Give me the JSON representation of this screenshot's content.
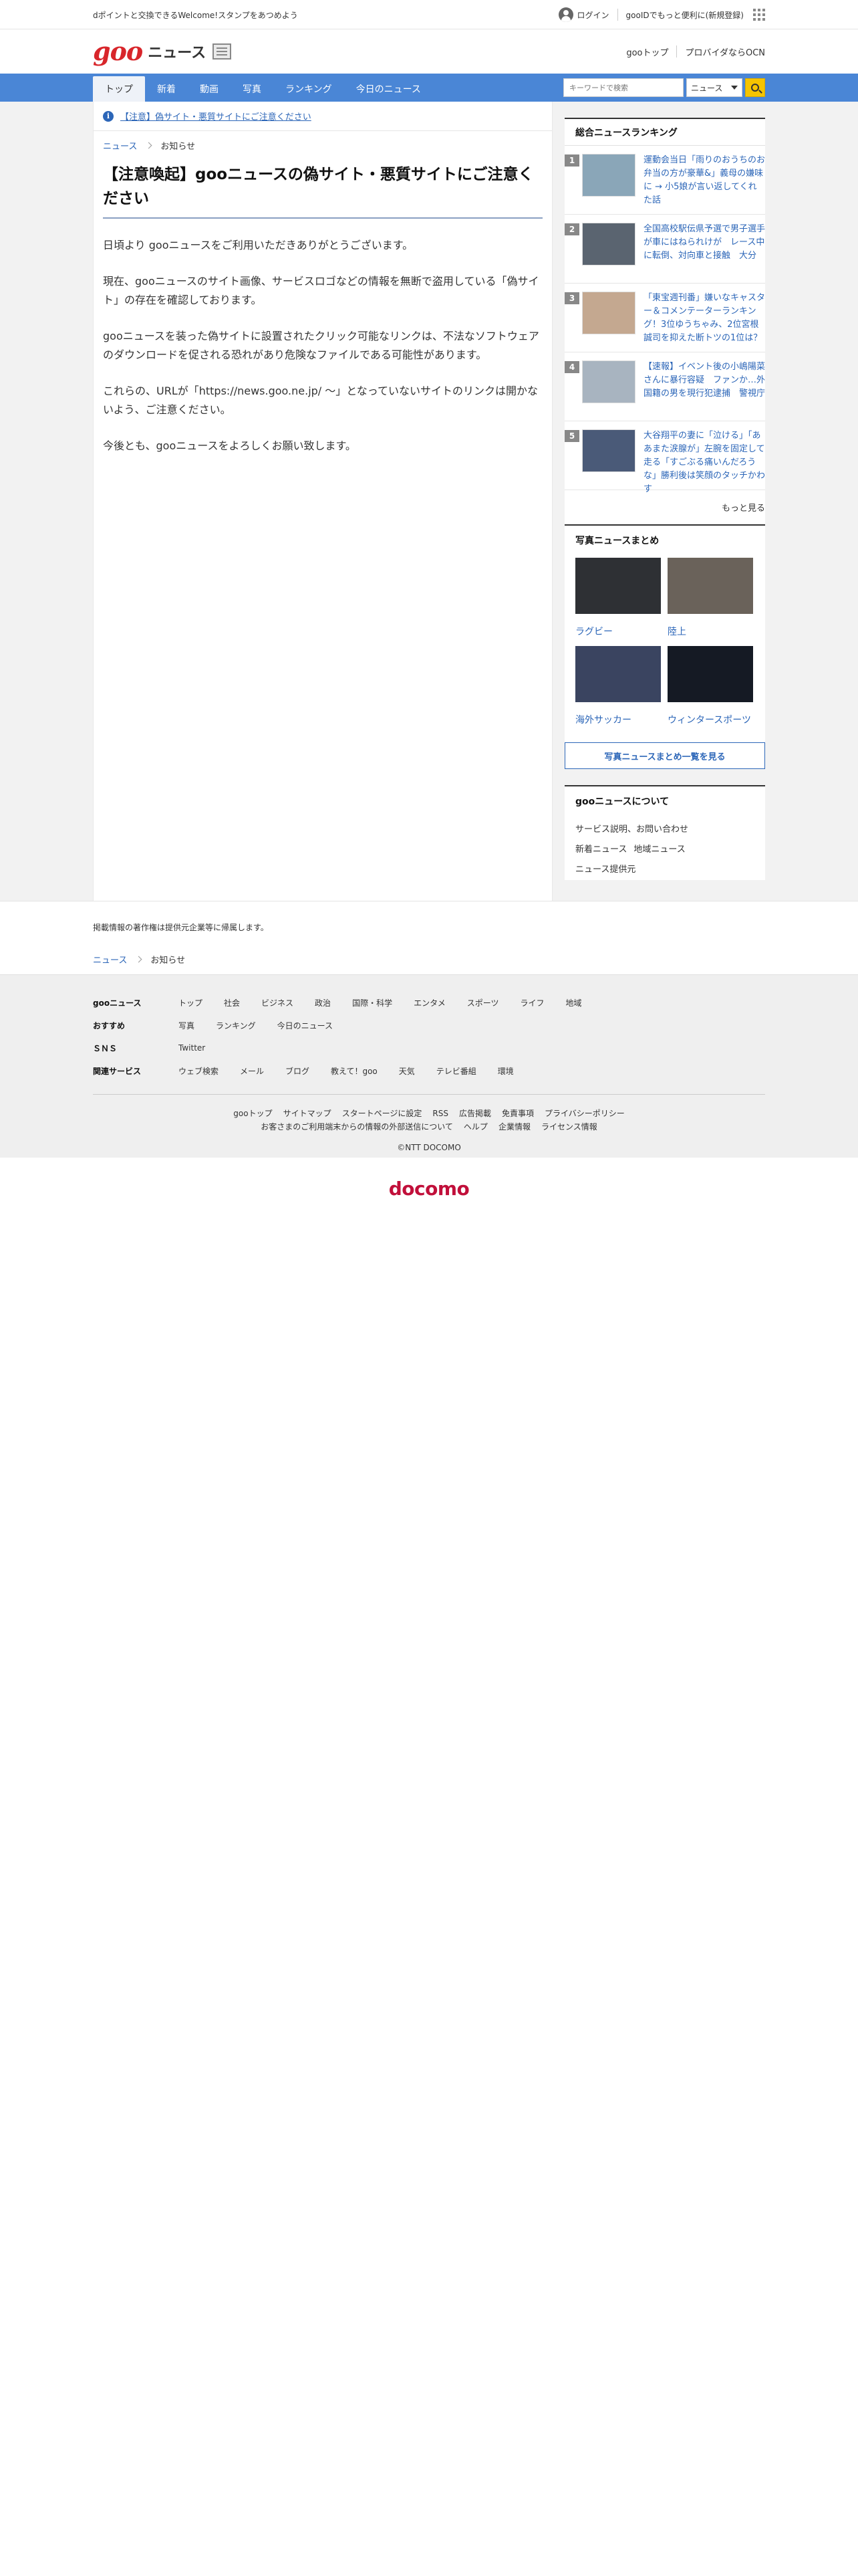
{
  "topbar": {
    "promo": "dポイントと交換できるWelcome!スタンプをあつめよう",
    "login": "ログイン",
    "register": "gooIDでもっと便利に(新規登録)"
  },
  "header": {
    "logo": "goo",
    "site_name": "ニュース",
    "links": [
      "gooトップ",
      "プロバイダならOCN"
    ]
  },
  "nav": {
    "tabs": [
      "トップ",
      "新着",
      "動画",
      "写真",
      "ランキング",
      "今日のニュース"
    ],
    "active_tab": "トップ",
    "search_placeholder": "キーワードで検索",
    "search_scope": "ニュース"
  },
  "notice": {
    "text": "【注意】偽サイト・悪質サイトにご注意ください"
  },
  "breadcrumb": {
    "items": [
      "ニュース",
      "お知らせ"
    ]
  },
  "article": {
    "title": "【注意喚起】gooニュースの偽サイト・悪質サイトにご注意ください",
    "paragraphs": [
      "日頃より gooニュースをご利用いただきありがとうございます。",
      "現在、gooニュースのサイト画像、サービスロゴなどの情報を無断で盗用している「偽サイト」の存在を確認しております。",
      "gooニュースを装った偽サイトに設置されたクリック可能なリンクは、不法なソフトウェアのダウンロードを促される恐れがあり危険なファイルである可能性があります。",
      "これらの、URLが「https://news.goo.ne.jp/ 〜」となっていないサイトのリンクは開かないよう、ご注意ください。",
      "今後とも、gooニュースをよろしくお願い致します。"
    ]
  },
  "ranking": {
    "title": "総合ニュースランキング",
    "items": [
      {
        "rank": "1",
        "text": "運動会当日「雨りのおうちのお弁当の方が豪華&」義母の嫌味に → 小5娘が言い返してくれた話",
        "thumb_color": "#8aa6b8"
      },
      {
        "rank": "2",
        "text": "全国高校駅伝県予選で男子選手が車にはねられけが　レース中に転倒、対向車と接触　大分",
        "thumb_color": "#5a6470"
      },
      {
        "rank": "3",
        "text": "「東宝週刊番」嫌いなキャスター＆コメンテーターランキング！3位ゆうちゃみ、2位宮根誠司を抑えた断トツの1位は？",
        "thumb_color": "#c4a890"
      },
      {
        "rank": "4",
        "text": "【速報】イベント後の小嶋陽菜さんに暴行容疑　ファンか…外国籍の男を現行犯逮捕　警視庁",
        "thumb_color": "#a8b4c0"
      },
      {
        "rank": "5",
        "text": "大谷翔平の妻に「泣ける」「ああまた涙腺が」左腕を固定して走る「すごぶる痛いんだろうな」勝利後は笑顔のタッチかわす",
        "thumb_color": "#4a5a78"
      }
    ],
    "more": "もっと見る"
  },
  "photos": {
    "title": "写真ニュースまとめ",
    "items": [
      {
        "label": "ラグビー",
        "color": "#2e3034"
      },
      {
        "label": "陸上",
        "color": "#6a625a"
      },
      {
        "label": "海外サッカー",
        "color": "#3a4460"
      },
      {
        "label": "ウィンタースポーツ",
        "color": "#151a24"
      }
    ],
    "all_button": "写真ニュースまとめ一覧を見る"
  },
  "about": {
    "title": "gooニュースについて",
    "lines": [
      [
        "サービス説明、お問い合わせ"
      ],
      [
        "新着ニュース",
        "地域ニュース"
      ],
      [
        "ニュース提供元"
      ]
    ]
  },
  "copyright_note": "掲載情報の著作権は提供元企業等に帰属します。",
  "footer": {
    "rows": [
      {
        "label": "gooニュース",
        "links": [
          "トップ",
          "社会",
          "ビジネス",
          "政治",
          "国際・科学",
          "エンタメ",
          "スポーツ",
          "ライフ",
          "地域"
        ]
      },
      {
        "label": "おすすめ",
        "links": [
          "写真",
          "ランキング",
          "今日のニュース"
        ]
      },
      {
        "label": "ＳＮＳ",
        "links": [
          "Twitter"
        ]
      },
      {
        "label": "関連サービス",
        "links": [
          "ウェブ検索",
          "メール",
          "ブログ",
          "教えて！goo",
          "天気",
          "テレビ番組",
          "環境"
        ]
      }
    ],
    "bottom_links_1": [
      "gooトップ",
      "サイトマップ",
      "スタートページに設定",
      "RSS",
      "広告掲載",
      "免責事項",
      "プライバシーポリシー"
    ],
    "bottom_links_2": [
      "お客さまのご利用端末からの情報の外部送信について",
      "ヘルプ",
      "企業情報",
      "ライセンス情報"
    ],
    "copyright": "©NTT DOCOMO"
  },
  "docomo_logo": "docomo"
}
